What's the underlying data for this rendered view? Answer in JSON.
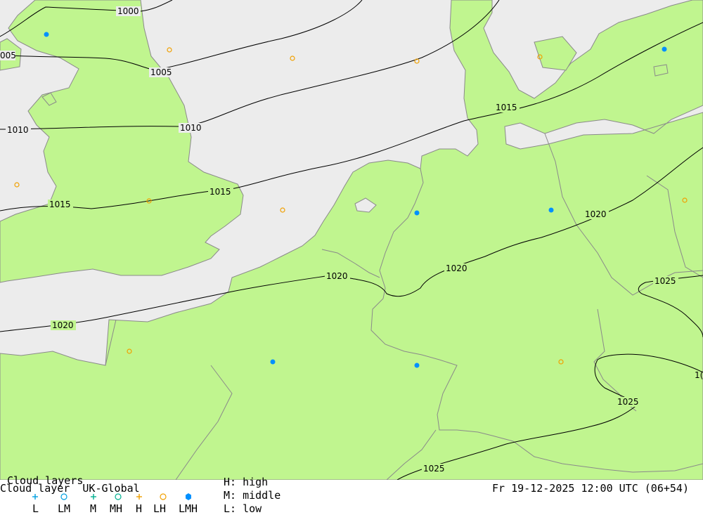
{
  "legend": {
    "heading": "Cloud layers",
    "title": "Cloud layer  UK-Global",
    "symbols": [
      {
        "label": "L",
        "icon": "plus-icon",
        "color": "#00a0e0"
      },
      {
        "label": "LM",
        "icon": "circle-icon",
        "color": "#00a0e0"
      },
      {
        "label": "M",
        "icon": "plus-icon",
        "color": "#00b090"
      },
      {
        "label": "MH",
        "icon": "circle-icon",
        "color": "#00b090"
      },
      {
        "label": "H",
        "icon": "plus-icon",
        "color": "#f0a000"
      },
      {
        "label": "LH",
        "icon": "circle-icon",
        "color": "#f0a000"
      },
      {
        "label": "LMH",
        "icon": "filled-hexagon-icon",
        "color": "#0090ff"
      }
    ],
    "key_high": "H: high",
    "key_middle": "M: middle",
    "key_low": "L: low"
  },
  "timestamp": "Fr 19-12-2025 12:00 UTC (06+54)",
  "isobars": [
    "1000",
    "005",
    "1005",
    "1010",
    "1010",
    "1015",
    "1015",
    "1015",
    "1020",
    "1020",
    "1020",
    "1020",
    "1025",
    "1025",
    "1025",
    "1("
  ],
  "colors": {
    "land": "#c0f58f",
    "sea": "#ececec",
    "border": "#8a8a8a",
    "isobar": "#000000",
    "high_cloud": "#f0a000",
    "full_cloud": "#0090ff"
  }
}
